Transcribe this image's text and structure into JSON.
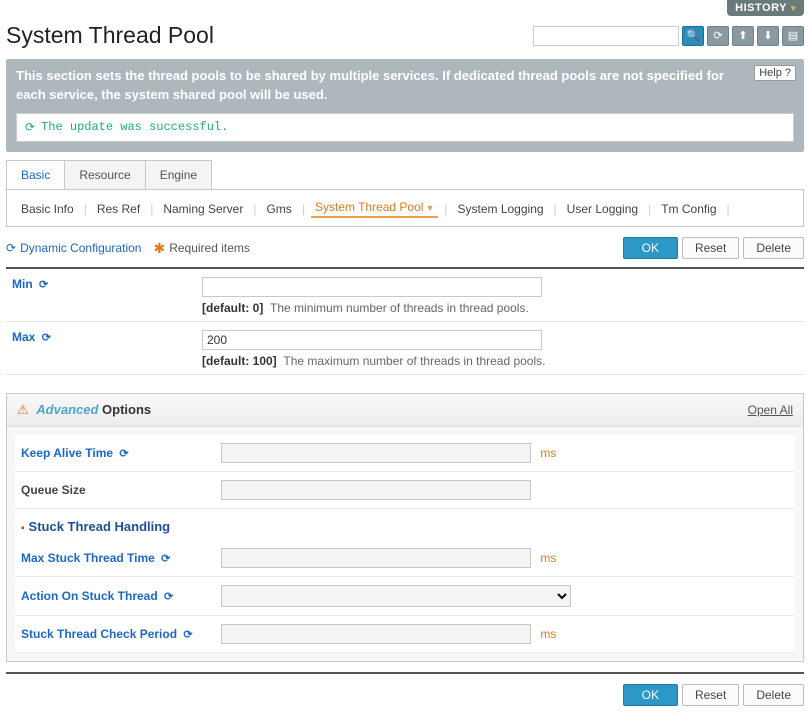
{
  "topbar": {
    "history": "HISTORY"
  },
  "page_title": "System Thread Pool",
  "search": {
    "placeholder": ""
  },
  "banner": {
    "text": "This section sets the thread pools to be shared by multiple services. If dedicated thread pools are not specified for each service, the system shared pool will be used.",
    "help": "Help ?"
  },
  "message": {
    "text": "The update was successful."
  },
  "tabs": {
    "basic": "Basic",
    "resource": "Resource",
    "engine": "Engine"
  },
  "subnav": {
    "basic_info": "Basic Info",
    "res_ref": "Res Ref",
    "naming_server": "Naming Server",
    "gms": "Gms",
    "system_thread_pool": "System Thread Pool",
    "system_logging": "System Logging",
    "user_logging": "User Logging",
    "tm_config": "Tm Config"
  },
  "legend": {
    "dynamic": "Dynamic Configuration",
    "required": "Required items"
  },
  "actions": {
    "ok": "OK",
    "reset": "Reset",
    "delete": "Delete"
  },
  "fields": {
    "min": {
      "label": "Min",
      "value": "",
      "default": "[default: 0]",
      "desc": "The minimum number of threads in thread pools."
    },
    "max": {
      "label": "Max",
      "value": "200",
      "default": "[default: 100]",
      "desc": "The maximum number of threads in thread pools."
    }
  },
  "advanced": {
    "title_adv": "Advanced",
    "title_opts": "Options",
    "open_all": "Open All",
    "keep_alive": {
      "label": "Keep Alive Time",
      "unit": "ms"
    },
    "queue_size": {
      "label": "Queue Size"
    },
    "stuck_section": "Stuck Thread Handling",
    "max_stuck": {
      "label": "Max Stuck Thread Time",
      "unit": "ms"
    },
    "action_on_stuck": {
      "label": "Action On Stuck Thread"
    },
    "check_period": {
      "label": "Stuck Thread Check Period",
      "unit": "ms"
    }
  }
}
